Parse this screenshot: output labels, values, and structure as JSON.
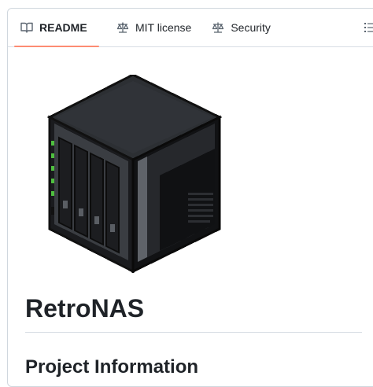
{
  "tabs": [
    {
      "label": "README",
      "icon": "book-icon",
      "active": true
    },
    {
      "label": "MIT license",
      "icon": "law-icon",
      "active": false
    },
    {
      "label": "Security",
      "icon": "law-icon",
      "active": false
    }
  ],
  "outline_button": {
    "icon": "list-unordered-icon"
  },
  "readme": {
    "title": "RetroNAS",
    "section_heading": "Project Information"
  },
  "colors": {
    "active_tab_underline": "#fd8c73",
    "led_green": "#4fbf3f"
  }
}
